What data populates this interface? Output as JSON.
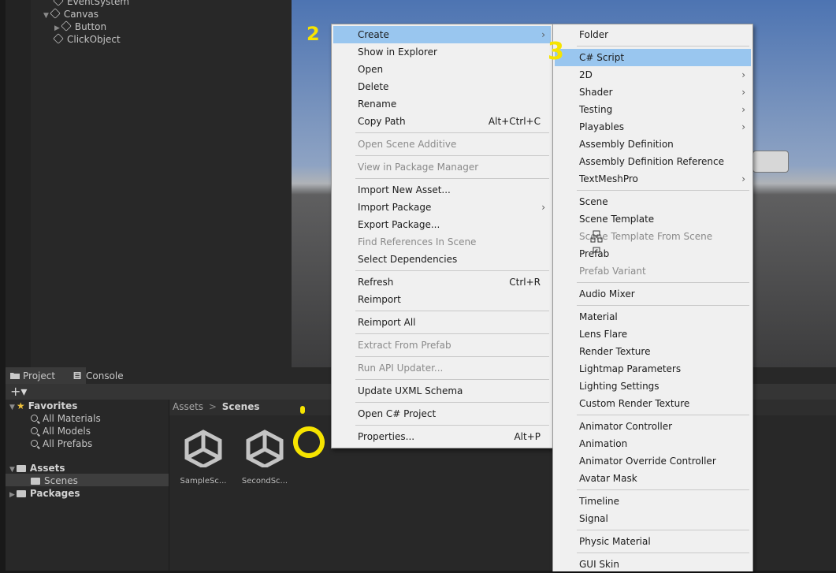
{
  "hierarchy": {
    "items": [
      {
        "label": "EventSystem"
      },
      {
        "label": "Canvas"
      },
      {
        "label": "Button"
      },
      {
        "label": "ClickObject"
      }
    ]
  },
  "project": {
    "tabs": [
      {
        "label": "Project",
        "icon": "folder-icon"
      },
      {
        "label": "Console",
        "icon": "console-icon"
      }
    ],
    "toolbar": {
      "add_label": "+▾"
    },
    "tree": {
      "favorites": "Favorites",
      "fav_items": [
        "All Materials",
        "All Models",
        "All Prefabs"
      ],
      "assets": "Assets",
      "scenes": "Scenes",
      "packages": "Packages"
    },
    "breadcrumb": {
      "root": "Assets",
      "sep": ">",
      "current": "Scenes"
    },
    "assets": [
      "SampleSc...",
      "SecondSc..."
    ]
  },
  "context_menu": {
    "items": [
      {
        "label": "Create",
        "arrow": "›"
      },
      {
        "label": "Show in Explorer"
      },
      {
        "label": "Open"
      },
      {
        "label": "Delete"
      },
      {
        "label": "Rename"
      },
      {
        "label": "Copy Path",
        "shortcut": "Alt+Ctrl+C"
      },
      {
        "label": "Open Scene Additive"
      },
      {
        "label": "View in Package Manager"
      },
      {
        "label": "Import New Asset..."
      },
      {
        "label": "Import Package",
        "arrow": "›"
      },
      {
        "label": "Export Package..."
      },
      {
        "label": "Find References In Scene"
      },
      {
        "label": "Select Dependencies"
      },
      {
        "label": "Refresh",
        "shortcut": "Ctrl+R"
      },
      {
        "label": "Reimport"
      },
      {
        "label": "Reimport All"
      },
      {
        "label": "Extract From Prefab"
      },
      {
        "label": "Run API Updater..."
      },
      {
        "label": "Update UXML Schema"
      },
      {
        "label": "Open C# Project"
      },
      {
        "label": "Properties...",
        "shortcut": "Alt+P"
      }
    ]
  },
  "create_menu": {
    "items": [
      {
        "label": "Folder"
      },
      {
        "label": "C# Script"
      },
      {
        "label": "2D",
        "arrow": "›"
      },
      {
        "label": "Shader",
        "arrow": "›"
      },
      {
        "label": "Testing",
        "arrow": "›"
      },
      {
        "label": "Playables",
        "arrow": "›"
      },
      {
        "label": "Assembly Definition"
      },
      {
        "label": "Assembly Definition Reference"
      },
      {
        "label": "TextMeshPro",
        "arrow": "›"
      },
      {
        "label": "Scene"
      },
      {
        "label": "Scene Template"
      },
      {
        "label": "Scene Template From Scene"
      },
      {
        "label": "Prefab"
      },
      {
        "label": "Prefab Variant"
      },
      {
        "label": "Audio Mixer"
      },
      {
        "label": "Material"
      },
      {
        "label": "Lens Flare"
      },
      {
        "label": "Render Texture"
      },
      {
        "label": "Lightmap Parameters"
      },
      {
        "label": "Lighting Settings"
      },
      {
        "label": "Custom Render Texture"
      },
      {
        "label": "Animator Controller"
      },
      {
        "label": "Animation"
      },
      {
        "label": "Animator Override Controller"
      },
      {
        "label": "Avatar Mask"
      },
      {
        "label": "Timeline"
      },
      {
        "label": "Signal"
      },
      {
        "label": "Physic Material"
      },
      {
        "label": "GUI Skin"
      }
    ]
  },
  "annotations": {
    "step2": "2",
    "step3": "3"
  },
  "colors": {
    "highlight": "#99c6ef",
    "annotation": "#f6e400"
  }
}
